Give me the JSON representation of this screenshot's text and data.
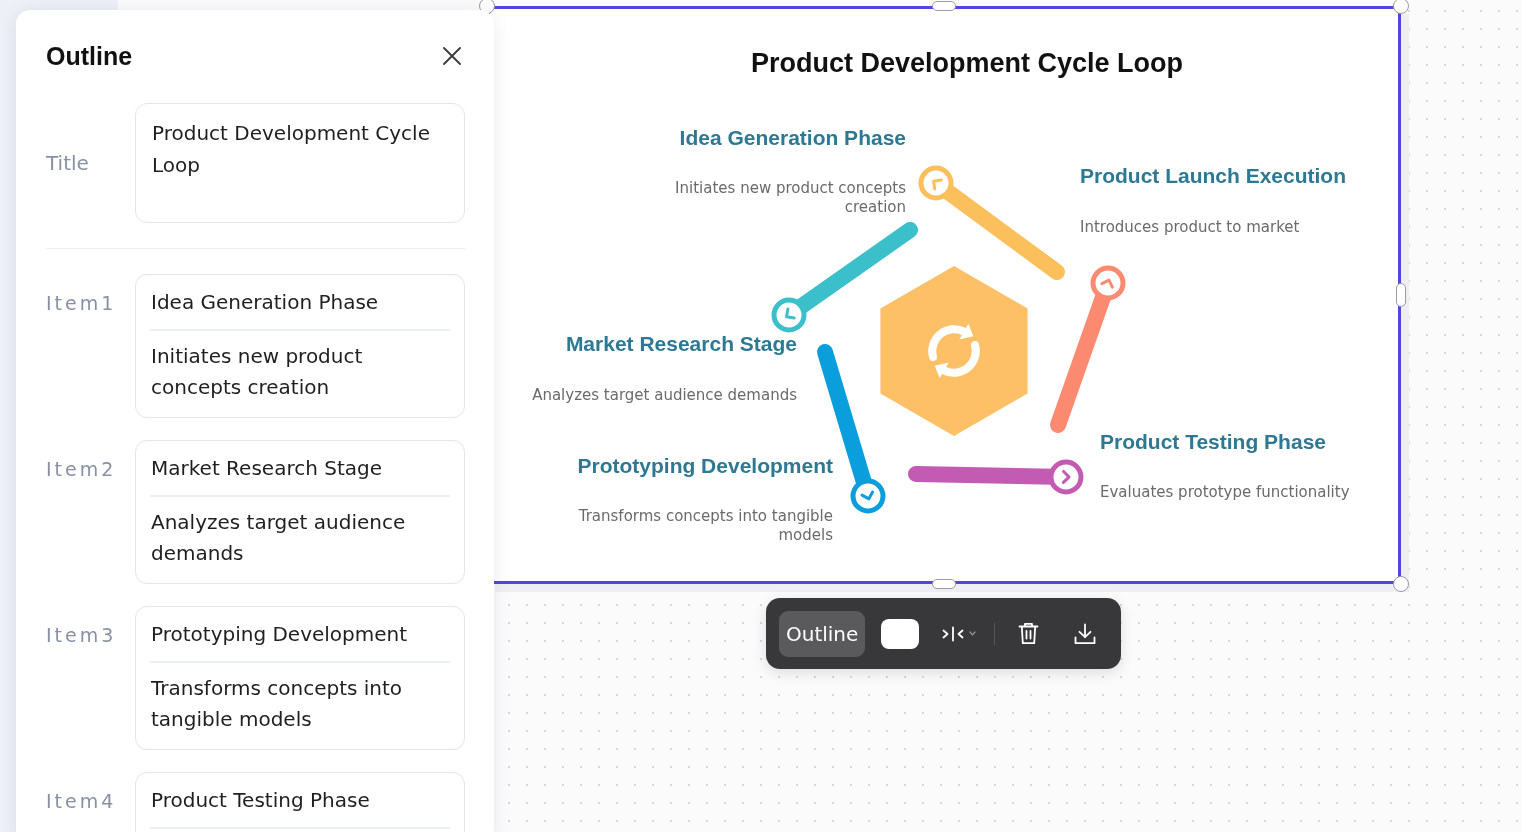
{
  "outline_panel": {
    "heading": "Outline",
    "title_field": {
      "label": "Title",
      "value": "Product Development Cycle Loop"
    },
    "items": [
      {
        "label": "Item1",
        "title": "Idea Generation Phase",
        "description": "Initiates new product concepts creation"
      },
      {
        "label": "Item2",
        "title": "Market Research Stage",
        "description": "Analyzes target audience demands"
      },
      {
        "label": "Item3",
        "title": "Prototyping Development",
        "description": "Transforms concepts into tangible models"
      },
      {
        "label": "Item4",
        "title": "Product Testing Phase"
      }
    ]
  },
  "infographic": {
    "selected": true,
    "title": "Product Development Cycle Loop",
    "steps": [
      {
        "title": "Idea Generation Phase",
        "description": "Initiates new product concepts creation",
        "color": "#fbbf5c"
      },
      {
        "title": "Product Launch Execution",
        "description": "Introduces product to market",
        "color": "#fc8a70"
      },
      {
        "title": "Market Research Stage",
        "description": "Analyzes target audience demands",
        "color": "#3bbfca"
      },
      {
        "title": "Product Testing Phase",
        "description": "Evaluates prototype functionality",
        "color": "#c35bb3"
      },
      {
        "title": "Prototyping Development",
        "description": "Transforms concepts into tangible models",
        "color": "#0a9fdc"
      }
    ]
  },
  "toolbar": {
    "outline_button": {
      "label": "Outline",
      "active": true
    }
  }
}
